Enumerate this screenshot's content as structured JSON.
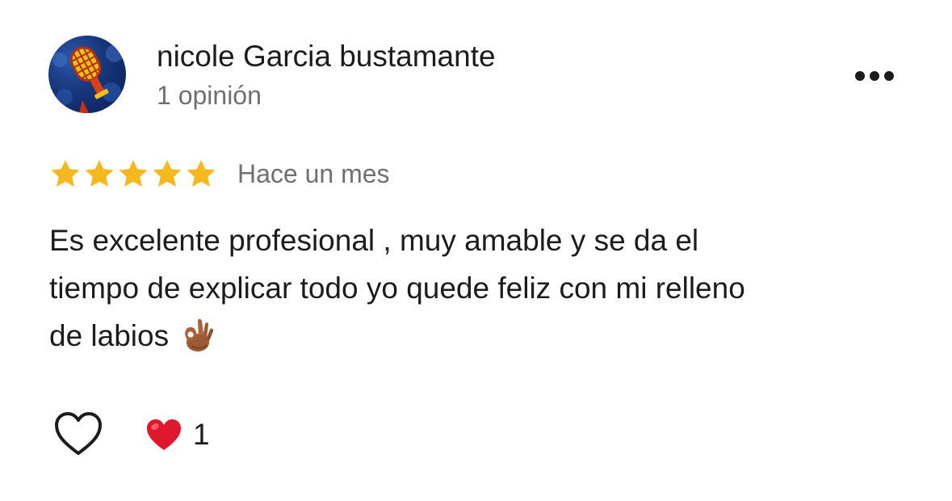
{
  "review": {
    "author_name": "nicole Garcia bustamante",
    "author_review_count": "1 opinión",
    "rating": 5,
    "rating_max": 5,
    "timestamp": "Hace un mes",
    "text_lines": [
      "Es excelente profesional , muy amable y se da el",
      "tiempo de explicar todo yo quede feliz con mi relleno",
      "de labios"
    ],
    "reaction_count": "1"
  },
  "icons": {
    "avatar": "microphone-avatar",
    "more": "more-horizontal-icon",
    "star": "star-icon",
    "ok_hand": "ok-hand-emoji",
    "like": "heart-outline-icon",
    "reaction": "red-heart-emoji"
  },
  "colors": {
    "star": "#F6B81E",
    "text_primary": "#1C1C1E",
    "text_secondary": "#707074",
    "heart_red": "#E0182D"
  }
}
